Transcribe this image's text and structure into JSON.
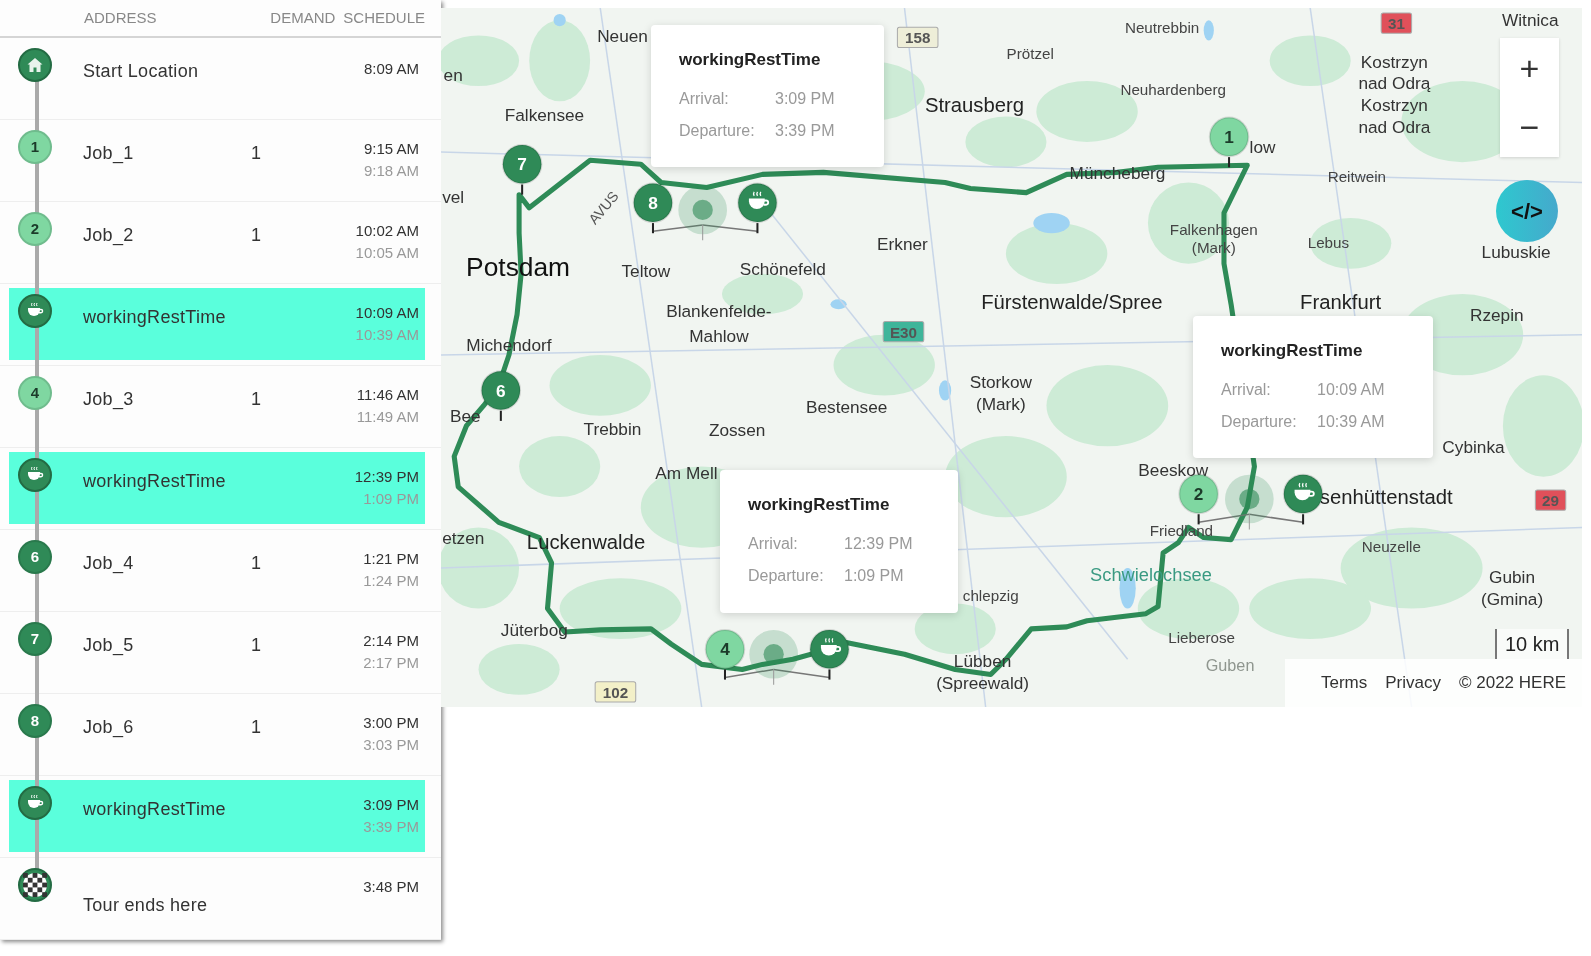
{
  "itinerary": {
    "columns": [
      "ADDRESS",
      "DEMAND",
      "SCHEDULE"
    ],
    "rows": [
      {
        "kind": "start",
        "address": "Start Location",
        "arrival": "8:09 AM",
        "selected": false
      },
      {
        "kind": "job",
        "marker": "1",
        "color": "#7fd7a1",
        "address": "Job_1",
        "demand": "1",
        "arrival": "9:15 AM",
        "departure": "9:18 AM",
        "selected": false
      },
      {
        "kind": "job",
        "marker": "2",
        "color": "#7fd7a1",
        "address": "Job_2",
        "demand": "1",
        "arrival": "10:02 AM",
        "departure": "10:05 AM",
        "selected": false
      },
      {
        "kind": "rest",
        "address": "workingRestTime",
        "arrival": "10:09 AM",
        "departure": "10:39 AM",
        "selected": true
      },
      {
        "kind": "job",
        "marker": "4",
        "color": "#7fd7a1",
        "address": "Job_3",
        "demand": "1",
        "arrival": "11:46 AM",
        "departure": "11:49 AM",
        "selected": false
      },
      {
        "kind": "rest",
        "address": "workingRestTime",
        "arrival": "12:39 PM",
        "departure": "1:09 PM",
        "selected": true
      },
      {
        "kind": "job",
        "marker": "6",
        "color": "#2f8a57",
        "address": "Job_4",
        "demand": "1",
        "arrival": "1:21 PM",
        "departure": "1:24 PM",
        "selected": false
      },
      {
        "kind": "job",
        "marker": "7",
        "color": "#2f8a57",
        "address": "Job_5",
        "demand": "1",
        "arrival": "2:14 PM",
        "departure": "2:17 PM",
        "selected": false
      },
      {
        "kind": "job",
        "marker": "8",
        "color": "#2f8a57",
        "address": "Job_6",
        "demand": "1",
        "arrival": "3:00 PM",
        "departure": "3:03 PM",
        "selected": false
      },
      {
        "kind": "rest",
        "address": "workingRestTime",
        "arrival": "3:09 PM",
        "departure": "3:39 PM",
        "selected": true
      },
      {
        "kind": "end",
        "address": "Tour ends here",
        "arrival": "3:48 PM",
        "selected": false
      }
    ]
  },
  "map": {
    "labels": [
      {
        "text": "Neuen",
        "kind": "town"
      },
      {
        "text": "en",
        "kind": "town"
      },
      {
        "text": "Falkensee",
        "kind": "town"
      },
      {
        "text": "vel",
        "kind": "town"
      },
      {
        "text": "Potsdam",
        "kind": "city"
      },
      {
        "text": "Teltow",
        "kind": "town"
      },
      {
        "text": "Schönefeld",
        "kind": "town"
      },
      {
        "text": "Blankenfelde-",
        "kind": "town"
      },
      {
        "text": "Mahlow",
        "kind": "town"
      },
      {
        "text": "Erkner",
        "kind": "town"
      },
      {
        "text": "Strausberg",
        "kind": "large"
      },
      {
        "text": "Prötzel",
        "kind": "small"
      },
      {
        "text": "Neutrebbin",
        "kind": "small"
      },
      {
        "text": "Neuhardenberg",
        "kind": "small"
      },
      {
        "text": "Müncheberg",
        "kind": "town"
      },
      {
        "text": "low",
        "kind": "town"
      },
      {
        "text": "Kostrzyn",
        "kind": "town"
      },
      {
        "text": "nad Odrą",
        "kind": "town"
      },
      {
        "text": "Kostrzyn",
        "kind": "town"
      },
      {
        "text": "nad Odra",
        "kind": "town"
      },
      {
        "text": "Witnica",
        "kind": "town"
      },
      {
        "text": "Reitwein",
        "kind": "small"
      },
      {
        "text": "Lubuskie",
        "kind": "town"
      },
      {
        "text": "Falkenhagen",
        "kind": "small"
      },
      {
        "text": "(Mark)",
        "kind": "small"
      },
      {
        "text": "Lebus",
        "kind": "small"
      },
      {
        "text": "Fürstenwalde/Spree",
        "kind": "large"
      },
      {
        "text": "Frankfurt",
        "kind": "large"
      },
      {
        "text": "Rzepin",
        "kind": "town"
      },
      {
        "text": "Michendorf",
        "kind": "town"
      },
      {
        "text": "Storkow",
        "kind": "town"
      },
      {
        "text": "(Mark)",
        "kind": "town"
      },
      {
        "text": "Bestensee",
        "kind": "town"
      },
      {
        "text": "Bee",
        "kind": "town"
      },
      {
        "text": "Trebbin",
        "kind": "town"
      },
      {
        "text": "Zossen",
        "kind": "town"
      },
      {
        "text": "Am Mell",
        "kind": "town"
      },
      {
        "text": "Cybinka",
        "kind": "town"
      },
      {
        "text": "Beeskow",
        "kind": "town"
      },
      {
        "text": "senhüttenstadt",
        "kind": "large"
      },
      {
        "text": "Friedland",
        "kind": "small"
      },
      {
        "text": "Neuzelle",
        "kind": "small"
      },
      {
        "text": "Luckenwalde",
        "kind": "large"
      },
      {
        "text": "Schwielochsee",
        "kind": "water"
      },
      {
        "text": "Gubin",
        "kind": "town"
      },
      {
        "text": "(Gmina)",
        "kind": "town"
      },
      {
        "text": "chlepzig",
        "kind": "small"
      },
      {
        "text": "Jüterbog",
        "kind": "town"
      },
      {
        "text": "Lieberose",
        "kind": "small"
      },
      {
        "text": "Lübben",
        "kind": "town"
      },
      {
        "text": "(Spreewald)",
        "kind": "town"
      },
      {
        "text": "etzen",
        "kind": "town"
      },
      {
        "text": "Guben",
        "kind": "faded"
      },
      {
        "text": "AVUS",
        "kind": "road"
      }
    ],
    "road_shields": [
      {
        "text": "158",
        "color": "#eeeed8"
      },
      {
        "text": "31",
        "color": "#e0505a"
      },
      {
        "text": "E30",
        "color": "#3fb59a"
      },
      {
        "text": "29",
        "color": "#e0505a"
      },
      {
        "text": "102",
        "color": "#f3f0c8"
      }
    ],
    "markers": [
      {
        "kind": "job",
        "label": "7",
        "color": "#2f8a57"
      },
      {
        "kind": "job",
        "label": "8",
        "color": "#2f8a57"
      },
      {
        "kind": "rest",
        "color": "#2f8a57"
      },
      {
        "kind": "job",
        "label": "1",
        "color": "#7fd7a1"
      },
      {
        "kind": "job",
        "label": "6",
        "color": "#2f8a57"
      },
      {
        "kind": "job",
        "label": "4",
        "color": "#7fd7a1"
      },
      {
        "kind": "rest",
        "color": "#2f8a57"
      },
      {
        "kind": "job",
        "label": "2",
        "color": "#7fd7a1"
      },
      {
        "kind": "rest",
        "color": "#2f8a57"
      }
    ],
    "popups": [
      {
        "title": "workingRestTime",
        "arrival_label": "Arrival:",
        "arrival": "3:09 PM",
        "departure_label": "Departure:",
        "departure": "3:39 PM"
      },
      {
        "title": "workingRestTime",
        "arrival_label": "Arrival:",
        "arrival": "10:09 AM",
        "departure_label": "Departure:",
        "departure": "10:39 AM"
      },
      {
        "title": "workingRestTime",
        "arrival_label": "Arrival:",
        "arrival": "12:39 PM",
        "departure_label": "Departure:",
        "departure": "1:09 PM"
      }
    ],
    "zoom_in": "+",
    "zoom_out": "−",
    "code_button": "</>",
    "scale": "10 km",
    "attribution": [
      "Terms",
      "Privacy",
      "© 2022 HERE"
    ]
  }
}
